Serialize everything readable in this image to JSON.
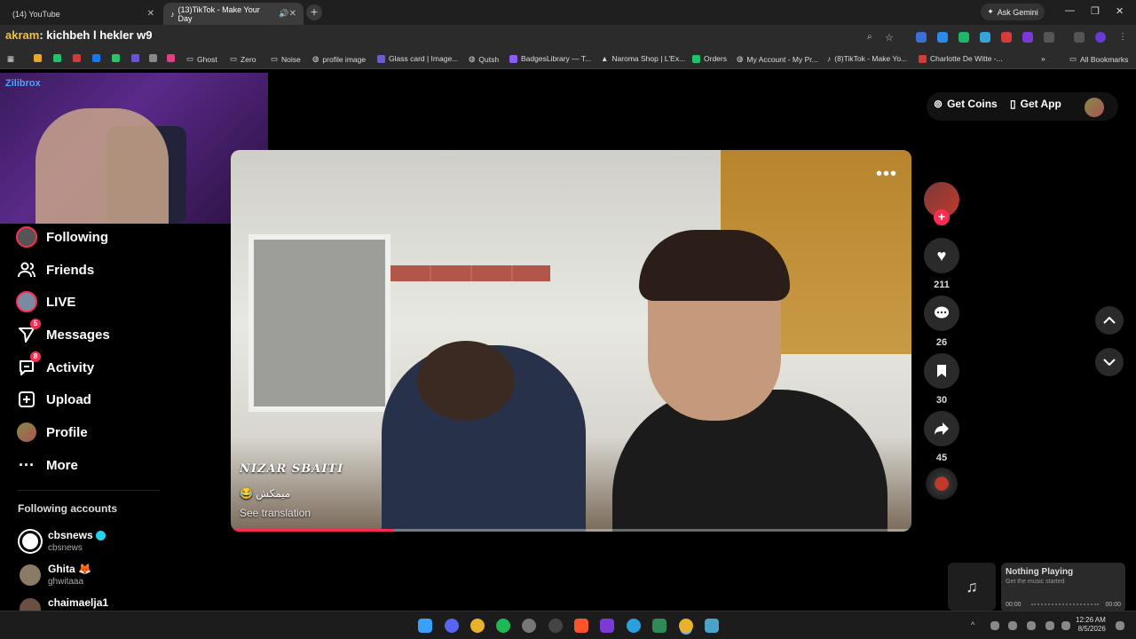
{
  "browser": {
    "tabs": [
      {
        "label": "(14) YouTube",
        "active": false
      },
      {
        "label": "(13)TikTok - Make Your Day",
        "active": true
      }
    ],
    "ask_gemini": "Ask Gemini",
    "address_overlay": {
      "prefix": "akram",
      "text": ": kichbeh l hekler w9"
    },
    "bookmarks": [
      "Ghost",
      "Zero",
      "Noise",
      "profile image",
      "Glass card | Image...",
      "Qutsh",
      "BadgesLibrary — T...",
      "Naroma Shop | L'Ex...",
      "Orders",
      "My Account - My Pr...",
      "(8)TikTok - Make Yo...",
      "Charlotte De Witte -..."
    ],
    "all_bookmarks": "All Bookmarks"
  },
  "webcam": {
    "label": "Zilibrox"
  },
  "header": {
    "get_coins": "Get Coins",
    "get_app": "Get App"
  },
  "nav": {
    "items": [
      {
        "label": "Following",
        "badge": ""
      },
      {
        "label": "Friends",
        "badge": ""
      },
      {
        "label": "LIVE",
        "badge": ""
      },
      {
        "label": "Messages",
        "badge": "5"
      },
      {
        "label": "Activity",
        "badge": "8"
      },
      {
        "label": "Upload",
        "badge": ""
      },
      {
        "label": "Profile",
        "badge": ""
      },
      {
        "label": "More",
        "badge": ""
      }
    ],
    "following_accounts_title": "Following accounts",
    "accounts": [
      {
        "name": "cbsnews",
        "handle": "cbsnews"
      },
      {
        "name": "Ghita",
        "handle": "ghwitaaa"
      },
      {
        "name": "chaimaelja1",
        "handle": ""
      }
    ]
  },
  "video": {
    "author": "NIZAR SBAITI",
    "caption": "😂 ميمكش",
    "see_translation": "See translation",
    "progress": 0.24
  },
  "actions": {
    "likes": "211",
    "comments": "26",
    "saves": "30",
    "shares": "45"
  },
  "music_widget": {
    "title": "Nothing Playing",
    "subtitle": "Get the music started",
    "time_start": "00:00",
    "time_end": "00:00"
  },
  "taskbar": {
    "time": "12:26 AM",
    "date": "8/5/2026"
  },
  "colors": {
    "accent": "#fe2c55",
    "verified": "#20d5ec",
    "bg": "#000000"
  }
}
